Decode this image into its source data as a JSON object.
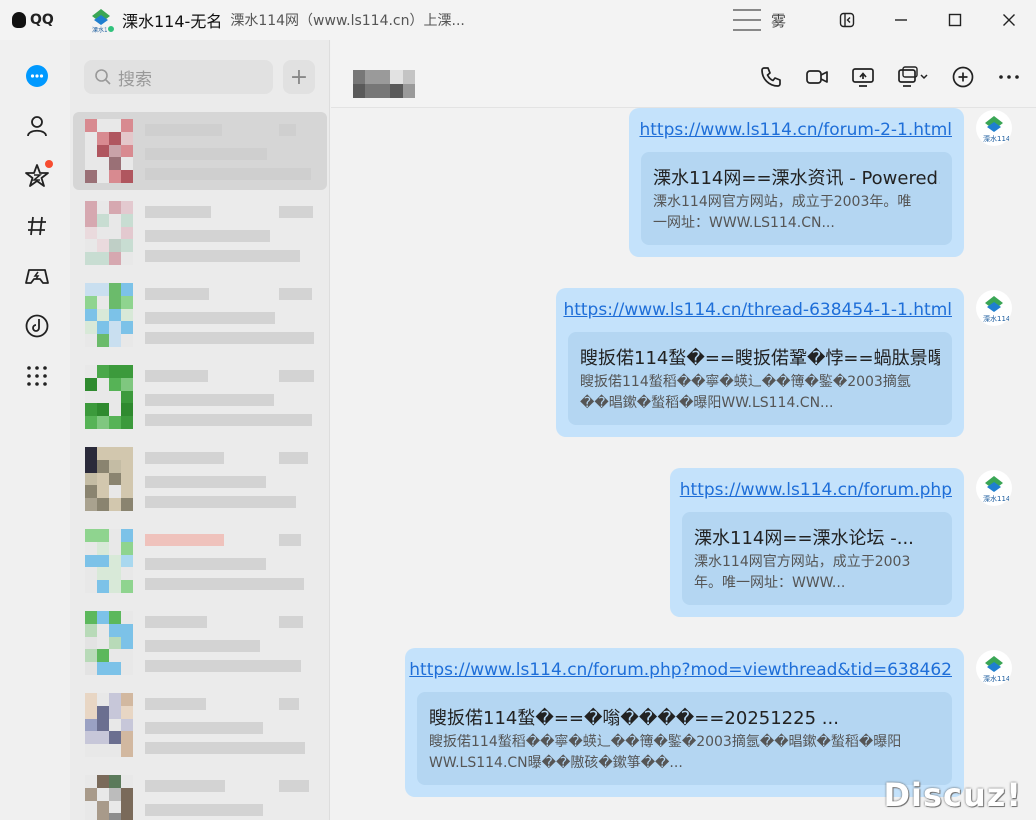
{
  "titlebar": {
    "app_name": "QQ",
    "chat_name": "溧水114-无名",
    "chat_desc": "溧水114网（www.ls114.cn）上溧...",
    "weather": "雾"
  },
  "search": {
    "placeholder": "搜索"
  },
  "messages": [
    {
      "link": "https://www.ls114.cn/forum-2-1.html",
      "card_title": "溧水114网==溧水资讯 - Powered...",
      "card_desc": "溧水114网官方网站，成立于2003年。唯一网址：WWW.LS114.CN..."
    },
    {
      "link": "https://www.ls114.cn/thread-638454-1-1.html",
      "card_title": "瞍扳偌114蝵�==瞍扳偌鞏�悖==蝸肽景曝...",
      "card_desc": "瞍扳偌114蝵稻��寧�蝧辶��簙�鍳�2003摘氬��晿鏉�蝵稻�曝阳WW.LS114.CN..."
    },
    {
      "link": "https://www.ls114.cn/forum.php",
      "card_title": "溧水114网==溧水论坛 -...",
      "card_desc": "溧水114网官方网站，成立于2003年。唯一网址：WWW..."
    },
    {
      "link": "https://www.ls114.cn/forum.php?mod=viewthread&tid=638462",
      "card_title": "瞍扳偌114蝵�==�嗡����==20251225 ...",
      "card_desc": "瞍扳偌114蝵稻��寧�蝧辶��簙�鍳�2003摘氬��晿鏉�蝵稻�曝阳WW.LS114.CN曝��隞硋�鏉箏��..."
    }
  ],
  "watermark": "Discuz!",
  "colors": {
    "bubble": "#c4e2fb",
    "card": "#b4d6f2",
    "link": "#1e6ed8",
    "badge": "#f74c30",
    "accent": "#0099ff"
  }
}
